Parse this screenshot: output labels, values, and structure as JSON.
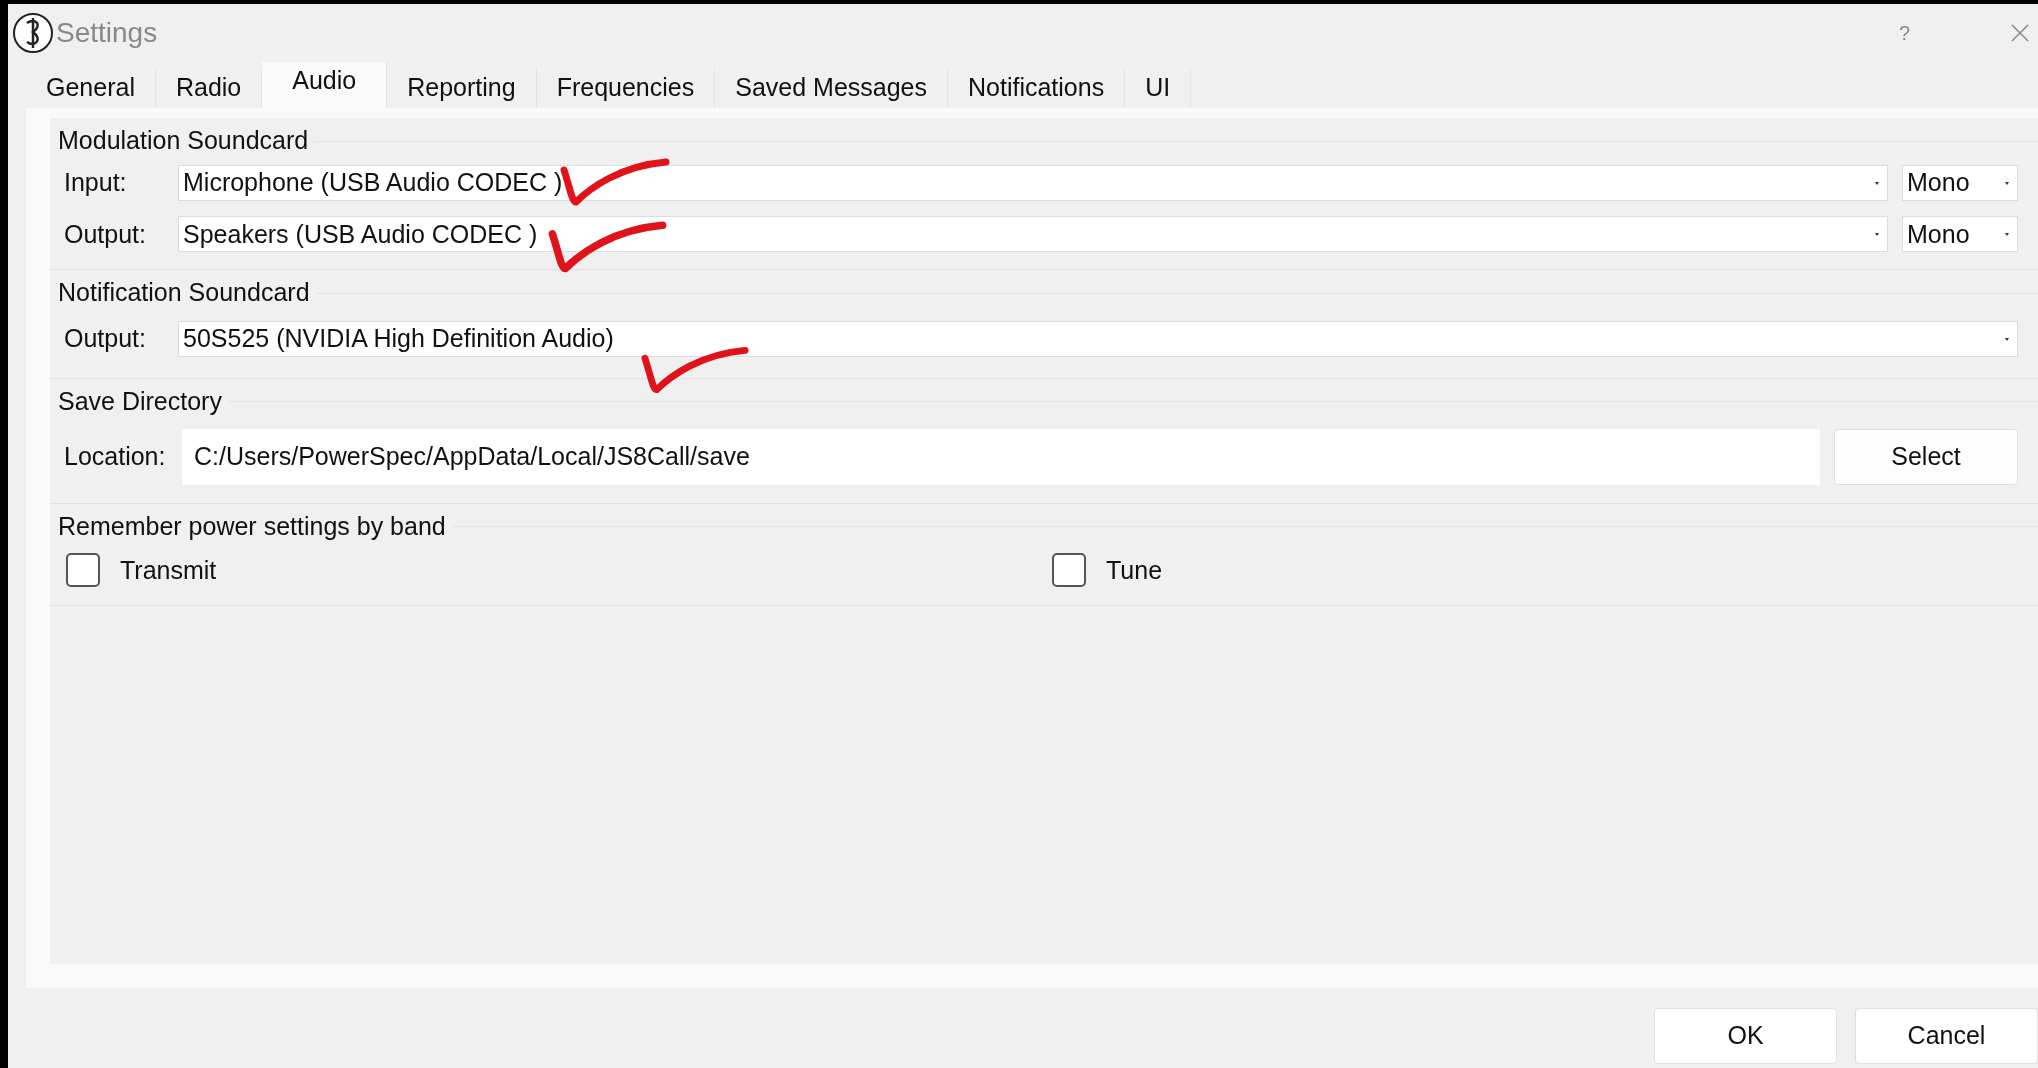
{
  "window": {
    "title": "Settings",
    "help": "?"
  },
  "tabs": [
    {
      "label": "General",
      "selected": false
    },
    {
      "label": "Radio",
      "selected": false
    },
    {
      "label": "Audio",
      "selected": true
    },
    {
      "label": "Reporting",
      "selected": false
    },
    {
      "label": "Frequencies",
      "selected": false
    },
    {
      "label": "Saved Messages",
      "selected": false
    },
    {
      "label": "Notifications",
      "selected": false
    },
    {
      "label": "UI",
      "selected": false
    }
  ],
  "modulation_soundcard": {
    "title": "Modulation Soundcard",
    "rows": [
      {
        "label": "Input:",
        "device": "Microphone (USB Audio CODEC )",
        "channel": "Mono"
      },
      {
        "label": "Output:",
        "device": "Speakers (USB Audio CODEC )",
        "channel": "Mono"
      }
    ]
  },
  "notification_soundcard": {
    "title": "Notification Soundcard",
    "label": "Output:",
    "device": "50S525 (NVIDIA High Definition Audio)"
  },
  "save_directory": {
    "title": "Save Directory",
    "label": "Location:",
    "value": "C:/Users/PowerSpec/AppData/Local/JS8Call/save",
    "button": "Select"
  },
  "power_settings": {
    "title": "Remember power settings by band",
    "checkboxes": [
      {
        "label": "Transmit",
        "checked": false
      },
      {
        "label": "Tune",
        "checked": false
      }
    ]
  },
  "buttons": [
    "OK",
    "Cancel"
  ]
}
